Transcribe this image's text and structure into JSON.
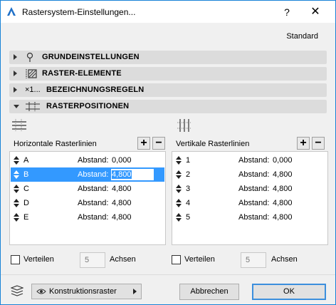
{
  "window": {
    "title": "Rastersystem-Einstellungen...",
    "help_label": "?",
    "close_label": "✕"
  },
  "preset": "Standard",
  "sections": [
    {
      "label": "GRUNDEINSTELLUNGEN",
      "icon": "pin-icon",
      "expanded": false
    },
    {
      "label": "RASTER-ELEMENTE",
      "icon": "grid-element-icon",
      "expanded": false
    },
    {
      "label": "BEZEICHNUNGSREGELN",
      "icon": "naming-rule-icon",
      "icon_text": "×1...",
      "expanded": false
    },
    {
      "label": "RASTERPOSITIONEN",
      "icon": "grid-position-icon",
      "expanded": true
    }
  ],
  "horizontal": {
    "title": "Horizontale Rasterlinien",
    "add": "+",
    "remove": "−",
    "rows": [
      {
        "name": "A",
        "label": "Abstand:",
        "value": "0,000"
      },
      {
        "name": "B",
        "label": "Abstand:",
        "value": "4,800"
      },
      {
        "name": "C",
        "label": "Abstand:",
        "value": "4,800"
      },
      {
        "name": "D",
        "label": "Abstand:",
        "value": "4,800"
      },
      {
        "name": "E",
        "label": "Abstand:",
        "value": "4,800"
      }
    ],
    "distribute_label": "Verteilen",
    "axes_value": "5",
    "axes_label": "Achsen"
  },
  "vertical": {
    "title": "Vertikale Rasterlinien",
    "add": "+",
    "remove": "−",
    "rows": [
      {
        "name": "1",
        "label": "Abstand:",
        "value": "0,000"
      },
      {
        "name": "2",
        "label": "Abstand:",
        "value": "4,800"
      },
      {
        "name": "3",
        "label": "Abstand:",
        "value": "4,800"
      },
      {
        "name": "4",
        "label": "Abstand:",
        "value": "4,800"
      },
      {
        "name": "5",
        "label": "Abstand:",
        "value": "4,800"
      }
    ],
    "distribute_label": "Verteilen",
    "axes_value": "5",
    "axes_label": "Achsen"
  },
  "footer": {
    "layer_dropdown": "Konstruktionsraster",
    "cancel": "Abbrechen",
    "ok": "OK"
  },
  "colors": {
    "selection": "#3399ff",
    "window_border": "#1883d7",
    "ok_border": "#3c8fdd"
  }
}
